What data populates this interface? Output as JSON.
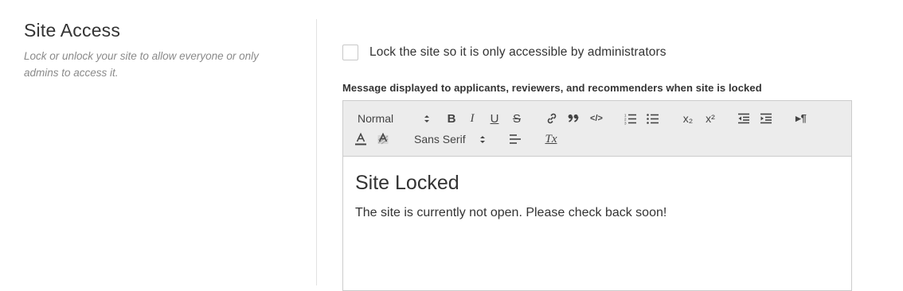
{
  "section": {
    "title": "Site Access",
    "description": "Lock or unlock your site to allow everyone or only admins to access it."
  },
  "lock": {
    "checkbox_label": "Lock the site so it is only accessible by administrators",
    "checked": false
  },
  "message": {
    "label": "Message displayed to applicants, reviewers, and recommenders when site is locked",
    "toolbar": {
      "header_picker": "Normal",
      "font_picker": "Sans Serif",
      "bold": "B",
      "italic": "I",
      "underline": "U",
      "strike": "S",
      "quote": "”",
      "code": "</>",
      "subscript": "x₂",
      "superscript": "x²",
      "rtl": "▸¶",
      "clean": "Tx"
    },
    "content": {
      "heading": "Site Locked",
      "body": "The site is currently not open. Please check back soon!"
    }
  }
}
